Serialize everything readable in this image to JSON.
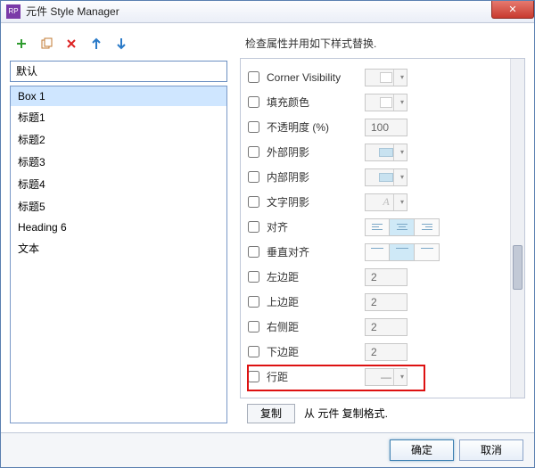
{
  "window": {
    "title": "元件 Style Manager",
    "app_icon_text": "RP",
    "close_glyph": "✕"
  },
  "toolbar_icons": [
    "plus",
    "copy",
    "delete",
    "up",
    "down"
  ],
  "search": {
    "value": "默认"
  },
  "styles": {
    "items": [
      "Box 1",
      "标题1",
      "标题2",
      "标题3",
      "标题4",
      "标题5",
      "Heading 6",
      "文本"
    ],
    "selected_index": 0
  },
  "right": {
    "header": "检查属性并用如下样式替换."
  },
  "props": [
    {
      "key": "corner_visibility",
      "label": "Corner Visibility",
      "control": "dropdown-split"
    },
    {
      "key": "fill_color",
      "label": "填充颜色",
      "control": "color-split"
    },
    {
      "key": "opacity",
      "label": "不透明度 (%)",
      "control": "number",
      "value": "100"
    },
    {
      "key": "outer_shadow",
      "label": "外部阴影",
      "control": "shadow-split"
    },
    {
      "key": "inner_shadow",
      "label": "内部阴影",
      "control": "shadow-split"
    },
    {
      "key": "text_shadow",
      "label": "文字阴影",
      "control": "text-shadow-split"
    },
    {
      "key": "align",
      "label": "对齐",
      "control": "halign"
    },
    {
      "key": "valign",
      "label": "垂直对齐",
      "control": "valign"
    },
    {
      "key": "margin_left",
      "label": "左边距",
      "control": "number",
      "value": "2"
    },
    {
      "key": "margin_top",
      "label": "上边距",
      "control": "number",
      "value": "2"
    },
    {
      "key": "margin_right",
      "label": "右侧距",
      "control": "number",
      "value": "2"
    },
    {
      "key": "margin_bottom",
      "label": "下边距",
      "control": "number",
      "value": "2"
    },
    {
      "key": "line_spacing",
      "label": "行距",
      "control": "line-spacing"
    }
  ],
  "highlight_prop_key": "line_spacing",
  "copy_row": {
    "button": "复制",
    "text": "从 元件 复制格式."
  },
  "footer": {
    "ok": "确定",
    "cancel": "取消"
  }
}
